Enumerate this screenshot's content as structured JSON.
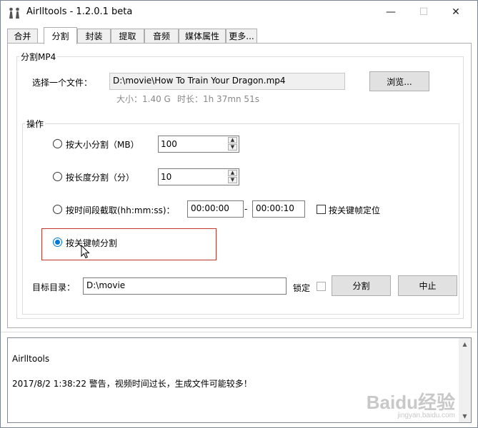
{
  "window": {
    "title": "Airlltools  -  1.2.0.1 beta",
    "minimize_glyph": "—",
    "maximize_glyph": "☐",
    "close_glyph": "✕"
  },
  "tabs": [
    {
      "label": "合并",
      "active": false
    },
    {
      "label": "分割",
      "active": true
    },
    {
      "label": "封装",
      "active": false
    },
    {
      "label": "提取",
      "active": false
    },
    {
      "label": "音频",
      "active": false
    },
    {
      "label": "媒体属性",
      "active": false
    },
    {
      "label": "更多...",
      "active": false
    }
  ],
  "split_mp4": {
    "group_title": "分割MP4",
    "file_label": "选择一个文件：",
    "file_value": "D:\\movie\\How To Train Your Dragon.mp4",
    "browse_label": "浏览...",
    "size_text": "大小：1.40 G",
    "duration_text": "时长：1h 37mn 51s"
  },
  "operation": {
    "group_title": "操作",
    "by_size_label": "按大小分割（MB）",
    "by_size_value": "100",
    "by_length_label": "按长度分割（分）",
    "by_length_value": "10",
    "by_time_label": "按时间段截取(hh:mm:ss)：",
    "time_start": "00:00:00",
    "time_dash": "-",
    "time_end": "00:00:10",
    "keyframe_locate_label": "按关键帧定位",
    "by_keyframe_label": "按关键帧分割",
    "selected": "by_keyframe",
    "target_dir_label": "目标目录：",
    "target_dir_value": "D:\\movie",
    "lock_label": "锁定",
    "split_button": "分割",
    "stop_button": "中止"
  },
  "log": {
    "lines": [
      "Airlltools",
      "2017/8/2 1:38:22  警告，视频时间过长，生成文件可能较多！"
    ]
  },
  "watermark": {
    "text": "Baidu经验",
    "sub": "jingyan.baidu.com"
  },
  "colors": {
    "accent": "#0078d7",
    "highlight_box": "#c0392b"
  }
}
